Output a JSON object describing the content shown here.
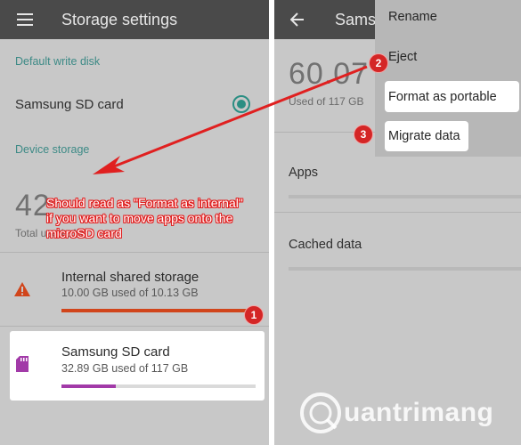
{
  "left_screen": {
    "title": "Storage settings",
    "default_write_header": "Default write disk",
    "default_write_option": "Samsung SD card",
    "device_storage_header": "Device storage",
    "total_number": "42",
    "total_used_label": "Total used of 1",
    "internal": {
      "title": "Internal shared storage",
      "usage": "10.00 GB used of 10.13 GB",
      "fill": 0.99
    },
    "sd": {
      "title": "Samsung SD card",
      "usage": "32.89 GB used of 117 GB",
      "fill": 0.28
    }
  },
  "right_screen": {
    "title": "Sams",
    "big_number": "60.07",
    "used_label": "Used of 117 GB",
    "apps_label": "Apps",
    "cached_label": "Cached data",
    "menu": {
      "rename": "Rename",
      "eject": "Eject",
      "format": "Format as portable",
      "migrate": "Migrate data"
    }
  },
  "annotations": {
    "note": "Should read as \"Format as internal\" if you want to move apps onto the microSD card",
    "badge1": "1",
    "badge2": "2",
    "badge3": "3"
  },
  "watermark": {
    "text": "uantrimang"
  },
  "colors": {
    "accent": "#2a8e83",
    "warning": "#d1451b",
    "sd_purple": "#a23aa8",
    "annotation_red": "#e02020"
  },
  "icons": [
    "menu-icon",
    "back-arrow-icon",
    "radio-selected-icon",
    "warning-icon",
    "sd-card-icon",
    "watermark-logo-icon"
  ]
}
